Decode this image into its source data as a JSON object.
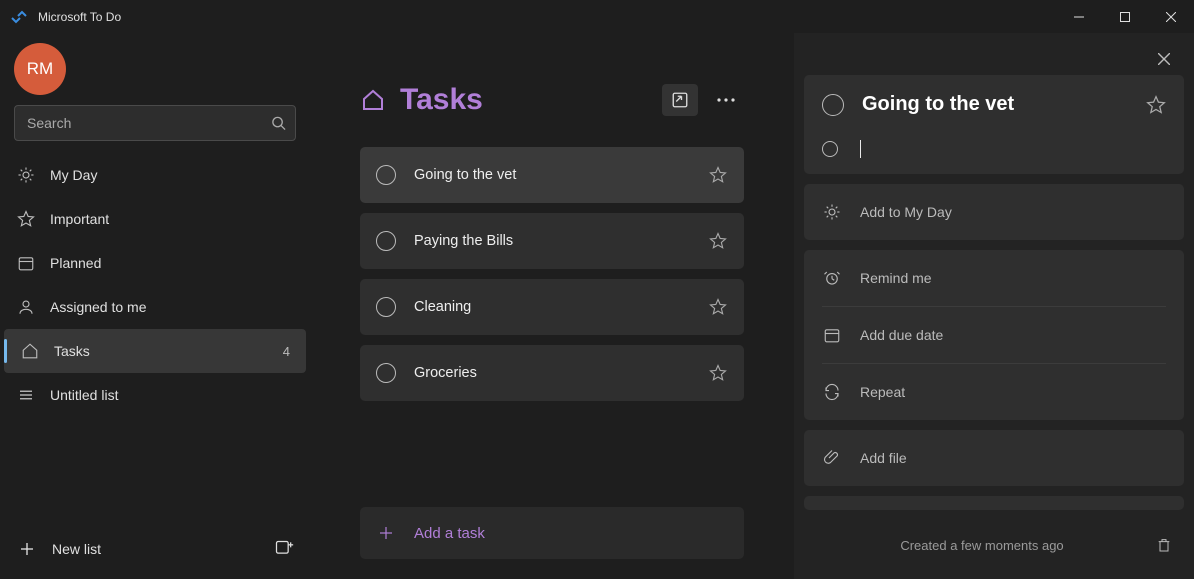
{
  "app": {
    "title": "Microsoft To Do"
  },
  "user": {
    "initials": "RM"
  },
  "search": {
    "placeholder": "Search"
  },
  "nav": {
    "my_day": "My Day",
    "important": "Important",
    "planned": "Planned",
    "assigned": "Assigned to me",
    "tasks": "Tasks",
    "tasks_count": "4",
    "untitled": "Untitled list"
  },
  "sidebar_footer": {
    "new_list": "New list"
  },
  "center": {
    "title": "Tasks",
    "tasks": [
      {
        "title": "Going to the vet"
      },
      {
        "title": "Paying the Bills"
      },
      {
        "title": "Cleaning"
      },
      {
        "title": "Groceries"
      }
    ],
    "add_placeholder": "Add a task"
  },
  "detail": {
    "title": "Going to the vet",
    "add_my_day": "Add to My Day",
    "remind": "Remind me",
    "due": "Add due date",
    "repeat": "Repeat",
    "add_file": "Add file",
    "created": "Created a few moments ago"
  },
  "accent_color": "#b17fd8"
}
